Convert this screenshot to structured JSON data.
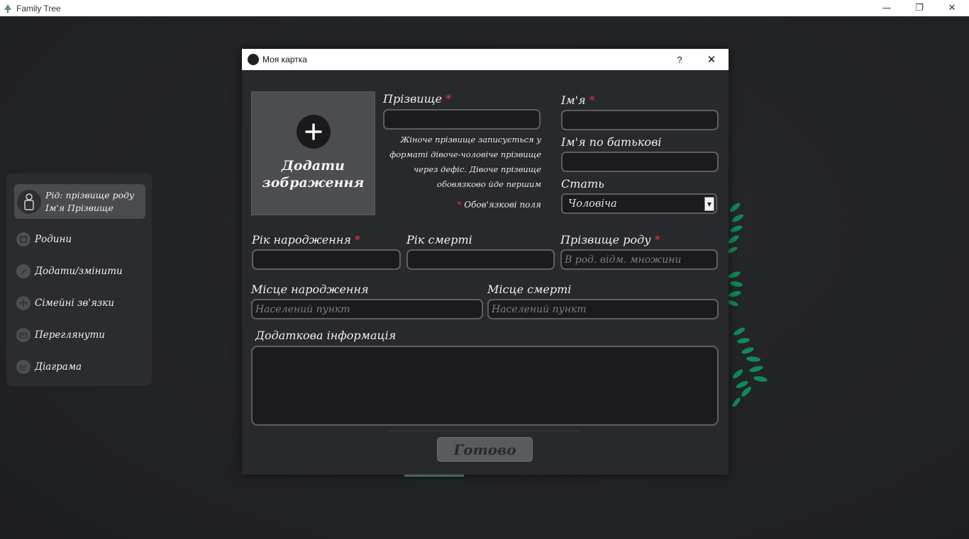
{
  "window": {
    "title": "Family Tree",
    "minimize": "—",
    "maximize": "❐",
    "close": "✕"
  },
  "sidebar": {
    "profile": {
      "line1": "Рід: прізвище роду",
      "line2": "Ім'я Прізвище",
      "icon": "person-icon"
    },
    "items": [
      {
        "label": "Родини",
        "icon": "family-icon"
      },
      {
        "label": "Додати/змінити",
        "icon": "edit-icon"
      },
      {
        "label": "Сімейні зв'язки",
        "icon": "relations-icon"
      },
      {
        "label": "Переглянути",
        "icon": "view-icon"
      },
      {
        "label": "Діаграма",
        "icon": "diagram-icon"
      }
    ]
  },
  "dialog": {
    "title": "Моя картка",
    "help": "?",
    "close": "✕",
    "add_image": {
      "line1": "Додати",
      "line2": "зображення",
      "plus": "+"
    },
    "surname": {
      "label": "Прізвище",
      "value": ""
    },
    "surname_note": "Жіноче прізвище записується у форматі дівоче-чоловіче прізвище через дефіс. Дівоче прізвище обовязково йде першим",
    "required_note": "Обов'язкові поля",
    "required_mark": "*",
    "first_name": {
      "label": "Ім'я",
      "value": ""
    },
    "patronymic": {
      "label": "Ім'я по батькові",
      "value": ""
    },
    "sex": {
      "label": "Стать",
      "value": "Чоловіча"
    },
    "birth_year": {
      "label": "Рік народження",
      "value": ""
    },
    "death_year": {
      "label": "Рік смерті",
      "value": ""
    },
    "family_name": {
      "label": "Прізвище роду",
      "placeholder": "В род. відм. множини"
    },
    "birth_place": {
      "label": "Місце народження",
      "placeholder": "Населений пункт"
    },
    "death_place": {
      "label": "Місце смерті",
      "placeholder": "Населений пункт"
    },
    "extra_info": {
      "label": "Додаткова інформація",
      "value": ""
    },
    "done_button": "Готово"
  },
  "colors": {
    "background": "#1f2022",
    "panel": "#2b2c2f",
    "dialog": "#28292c",
    "required": "#e53935",
    "leaf": "#0f8a5a"
  }
}
